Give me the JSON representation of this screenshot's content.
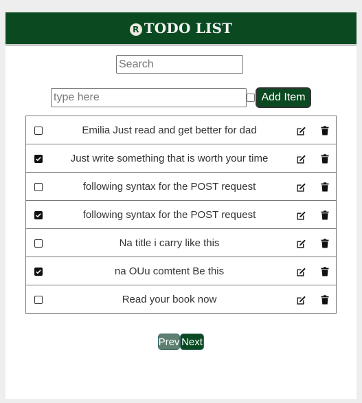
{
  "header": {
    "logo_letter": "R",
    "title": "TODO LIST",
    "background": "#0b4a21"
  },
  "search": {
    "placeholder": "Search",
    "value": ""
  },
  "new_item": {
    "placeholder": "type here",
    "value": "",
    "add_label": "Add Item"
  },
  "todos": [
    {
      "text": "Emilia Just read and get better for dad",
      "completed": false
    },
    {
      "text": "Just write something that is worth your time",
      "completed": true
    },
    {
      "text": "following syntax for the POST request",
      "completed": false
    },
    {
      "text": "following syntax for the POST request",
      "completed": true
    },
    {
      "text": "Na title i carry like this",
      "completed": false
    },
    {
      "text": "na OUu comtent Be this",
      "completed": true
    },
    {
      "text": "Read your book now",
      "completed": false
    }
  ],
  "icons": {
    "edit": "edit-icon",
    "delete": "trash-icon",
    "checkbox": "checkbox-icon"
  },
  "pagination": {
    "prev_label": "Prev",
    "next_label": "Next"
  }
}
